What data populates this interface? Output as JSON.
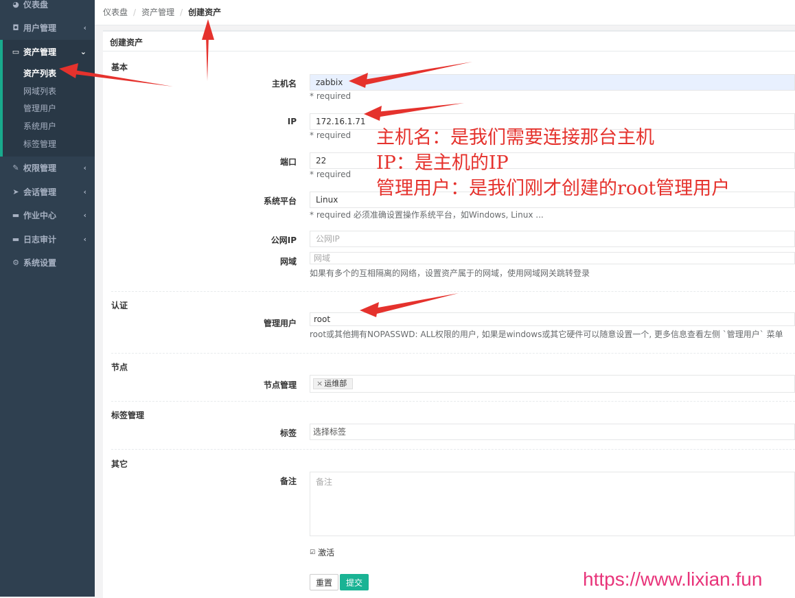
{
  "sidebar": {
    "items": [
      {
        "label": "仪表盘",
        "icon": "dashboard-icon",
        "glyph": "◕"
      },
      {
        "label": "用户管理",
        "icon": "users-icon",
        "glyph": "◘"
      },
      {
        "label": "资产管理",
        "icon": "inbox-icon",
        "glyph": "▭"
      },
      {
        "label": "权限管理",
        "icon": "edit-icon",
        "glyph": "✎"
      },
      {
        "label": "会话管理",
        "icon": "paper-plane-icon",
        "glyph": "➤"
      },
      {
        "label": "作业中心",
        "icon": "coffee-icon",
        "glyph": "▬"
      },
      {
        "label": "日志审计",
        "icon": "log-icon",
        "glyph": "▬"
      },
      {
        "label": "系统设置",
        "icon": "gears-icon",
        "glyph": "⚙"
      }
    ],
    "sub_items": [
      "资产列表",
      "网域列表",
      "管理用户",
      "系统用户",
      "标签管理"
    ]
  },
  "breadcrumb": [
    "仪表盘",
    "资产管理",
    "创建资产"
  ],
  "panel": {
    "title": "创建资产",
    "sections": {
      "basic": "基本",
      "auth": "认证",
      "node": "节点",
      "labels": "标签管理",
      "other": "其它"
    },
    "fields": {
      "hostname": {
        "label": "主机名",
        "value": "zabbix",
        "help": "* required"
      },
      "ip": {
        "label": "IP",
        "value": "172.16.1.71",
        "help": "* required"
      },
      "port": {
        "label": "端口",
        "value": "22",
        "help": "* required"
      },
      "platform": {
        "label": "系统平台",
        "value": "Linux",
        "help": "* required 必须准确设置操作系统平台，如Windows, Linux ..."
      },
      "public_ip": {
        "label": "公网IP",
        "placeholder": "公网IP"
      },
      "domain": {
        "label": "网域",
        "placeholder": "网域",
        "help": "如果有多个的互相隔离的网络，设置资产属于的网域，使用网域网关跳转登录"
      },
      "admin_user": {
        "label": "管理用户",
        "value": "root",
        "help": "root或其他拥有NOPASSWD: ALL权限的用户, 如果是windows或其它硬件可以随意设置一个, 更多信息查看左侧 `管理用户` 菜单"
      },
      "nodes": {
        "label": "节点管理",
        "tag": "运维部"
      },
      "labels": {
        "label": "标签",
        "placeholder": "选择标签"
      },
      "comment": {
        "label": "备注",
        "placeholder": "备注"
      },
      "active": {
        "label": "激活",
        "checked": true
      }
    },
    "buttons": {
      "reset": "重置",
      "submit": "提交"
    }
  },
  "annotation": {
    "lines": [
      "主机名：是我们需要连接那台主机",
      "IP：是主机的IP",
      "管理用户：是我们刚才创建的root管理用户"
    ],
    "color": "#e5322d"
  },
  "watermark": "https://www.lixian.fun",
  "colors": {
    "sidebar_bg": "#2f4050",
    "accent": "#1ab394",
    "arrow": "#e5322d"
  }
}
